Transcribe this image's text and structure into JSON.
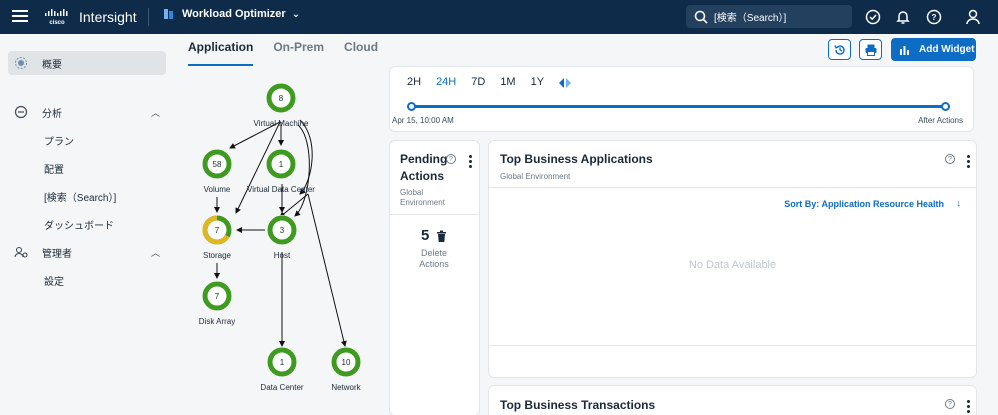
{
  "header": {
    "app_name": "Intersight",
    "product_name": "Workload Optimizer",
    "search_text": "[検索（Search）]",
    "icons": [
      "menu-icon",
      "cisco-logo",
      "search-icon",
      "check-circle-icon",
      "bell-icon",
      "help-icon",
      "user-icon"
    ]
  },
  "sidebar": {
    "items": [
      {
        "label": "概要",
        "icon": "overview-icon",
        "active": true
      },
      {
        "label": "分析",
        "icon": "analyze-icon",
        "expanded": true
      },
      {
        "label": "管理者",
        "icon": "admin-icon",
        "expanded": true
      }
    ],
    "analyze_sub": [
      "プラン",
      "配置",
      "[検索（Search）]",
      "ダッシュボード"
    ],
    "admin_sub": [
      "設定"
    ]
  },
  "tabs": [
    {
      "label": "Application",
      "active": true
    },
    {
      "label": "On-Prem",
      "active": false
    },
    {
      "label": "Cloud",
      "active": false
    }
  ],
  "toolbar": {
    "add_widget_label": "Add Widget",
    "icons": [
      "history-icon",
      "print-icon",
      "add-widget-icon"
    ]
  },
  "topology": {
    "nodes": [
      {
        "id": "vm",
        "label": "Virtual Machine",
        "count": "8"
      },
      {
        "id": "volume",
        "label": "Volume",
        "count": "58"
      },
      {
        "id": "vdc",
        "label": "Virtual Data Center",
        "count": "1"
      },
      {
        "id": "storage",
        "label": "Storage",
        "count": "7"
      },
      {
        "id": "host",
        "label": "Host",
        "count": "3"
      },
      {
        "id": "diskarray",
        "label": "Disk Array",
        "count": "7"
      },
      {
        "id": "datacenter",
        "label": "Data Center",
        "count": "1"
      },
      {
        "id": "network",
        "label": "Network",
        "count": "10"
      }
    ],
    "colors": {
      "healthy": "#3f9a20",
      "warning": "#e0b624"
    }
  },
  "timeline": {
    "options": [
      "2H",
      "24H",
      "7D",
      "1M",
      "1Y"
    ],
    "active": "24H",
    "start_label": "Apr 15, 10:00 AM",
    "end_label": "After Actions"
  },
  "pending": {
    "title": "Pending Actions",
    "subtitle": "Global Environment",
    "count": "5",
    "label": "Delete Actions"
  },
  "business_apps": {
    "title": "Top Business Applications",
    "subtitle": "Global Environment",
    "sort_label": "Sort By: Application Resource Health",
    "empty_text": "No Data Available"
  },
  "business_transactions": {
    "title": "Top Business Transactions"
  },
  "colors": {
    "header_bg": "#0e2b4a",
    "accent": "#0d6cc3"
  }
}
